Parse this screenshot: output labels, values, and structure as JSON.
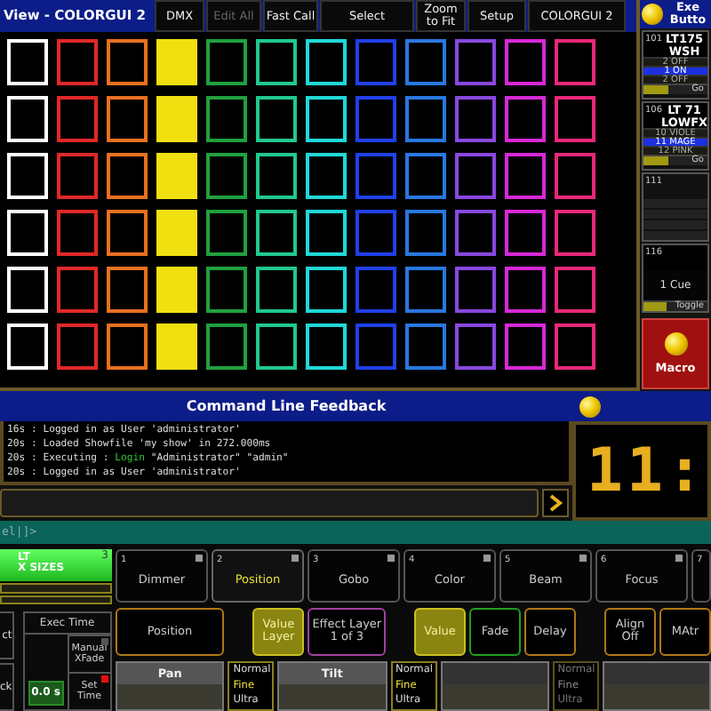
{
  "title_bar": {
    "title": "View - COLORGUI 2",
    "buttons": [
      {
        "label": "DMX",
        "disabled": false
      },
      {
        "label": "Edit All",
        "disabled": true
      },
      {
        "label": "Fast Call",
        "disabled": false
      },
      {
        "label": "Select",
        "disabled": false
      },
      {
        "label": "Zoom to Fit",
        "disabled": false
      },
      {
        "label": "Setup",
        "disabled": false
      },
      {
        "label": "COLORGUI 2",
        "disabled": false
      }
    ]
  },
  "color_grid": {
    "rows": [
      {
        "cells": [
          {
            "color": "#ffffff",
            "filled": false
          },
          {
            "color": "#e02828",
            "filled": false
          },
          {
            "color": "#e87020",
            "filled": false
          },
          {
            "color": "#f0e010",
            "filled": true
          },
          {
            "color": "#20a040",
            "filled": false
          },
          {
            "color": "#20c890",
            "filled": false
          },
          {
            "color": "#20d8d8",
            "filled": false
          },
          {
            "color": "#2040e8",
            "filled": false
          },
          {
            "color": "#2878e0",
            "filled": false
          },
          {
            "color": "#8848e0",
            "filled": false
          },
          {
            "color": "#d828d8",
            "filled": false
          },
          {
            "color": "#e82878",
            "filled": false
          }
        ]
      },
      {
        "cells": [
          {
            "color": "#ffffff",
            "filled": false
          },
          {
            "color": "#e02828",
            "filled": false
          },
          {
            "color": "#e87020",
            "filled": false
          },
          {
            "color": "#f0e010",
            "filled": true
          },
          {
            "color": "#20a040",
            "filled": false
          },
          {
            "color": "#20c890",
            "filled": false
          },
          {
            "color": "#20d8d8",
            "filled": false
          },
          {
            "color": "#2040e8",
            "filled": false
          },
          {
            "color": "#2878e0",
            "filled": false
          },
          {
            "color": "#8848e0",
            "filled": false
          },
          {
            "color": "#d828d8",
            "filled": false
          },
          {
            "color": "#e82878",
            "filled": false
          }
        ]
      },
      {
        "cells": [
          {
            "color": "#ffffff",
            "filled": false
          },
          {
            "color": "#e02828",
            "filled": false
          },
          {
            "color": "#e87020",
            "filled": false
          },
          {
            "color": "#f0e010",
            "filled": true
          },
          {
            "color": "#20a040",
            "filled": false
          },
          {
            "color": "#20c890",
            "filled": false
          },
          {
            "color": "#20d8d8",
            "filled": false
          },
          {
            "color": "#2040e8",
            "filled": false
          },
          {
            "color": "#2878e0",
            "filled": false
          },
          {
            "color": "#8848e0",
            "filled": false
          },
          {
            "color": "#d828d8",
            "filled": false
          },
          {
            "color": "#e82878",
            "filled": false
          }
        ]
      },
      {
        "cells": [
          {
            "color": "#ffffff",
            "filled": false
          },
          {
            "color": "#e02828",
            "filled": false
          },
          {
            "color": "#e87020",
            "filled": false
          },
          {
            "color": "#f0e010",
            "filled": true
          },
          {
            "color": "#20a040",
            "filled": false
          },
          {
            "color": "#20c890",
            "filled": false
          },
          {
            "color": "#20d8d8",
            "filled": false
          },
          {
            "color": "#2040e8",
            "filled": false
          },
          {
            "color": "#2878e0",
            "filled": false
          },
          {
            "color": "#8848e0",
            "filled": false
          },
          {
            "color": "#d828d8",
            "filled": false
          },
          {
            "color": "#e82878",
            "filled": false
          }
        ]
      },
      {
        "cells": [
          {
            "color": "#ffffff",
            "filled": false
          },
          {
            "color": "#e02828",
            "filled": false
          },
          {
            "color": "#e87020",
            "filled": false
          },
          {
            "color": "#f0e010",
            "filled": true
          },
          {
            "color": "#20a040",
            "filled": false
          },
          {
            "color": "#20c890",
            "filled": false
          },
          {
            "color": "#20d8d8",
            "filled": false
          },
          {
            "color": "#2040e8",
            "filled": false
          },
          {
            "color": "#2878e0",
            "filled": false
          },
          {
            "color": "#8848e0",
            "filled": false
          },
          {
            "color": "#d828d8",
            "filled": false
          },
          {
            "color": "#e82878",
            "filled": false
          }
        ]
      },
      {
        "cells": [
          {
            "color": "#ffffff",
            "filled": false
          },
          {
            "color": "#e02828",
            "filled": false
          },
          {
            "color": "#e87020",
            "filled": false
          },
          {
            "color": "#f0e010",
            "filled": true
          },
          {
            "color": "#20a040",
            "filled": false
          },
          {
            "color": "#20c890",
            "filled": false
          },
          {
            "color": "#20d8d8",
            "filled": false
          },
          {
            "color": "#2040e8",
            "filled": false
          },
          {
            "color": "#2878e0",
            "filled": false
          },
          {
            "color": "#8848e0",
            "filled": false
          },
          {
            "color": "#d828d8",
            "filled": false
          },
          {
            "color": "#e82878",
            "filled": false
          }
        ]
      }
    ]
  },
  "executor_panel": {
    "title": "Exe Butto",
    "executors": [
      {
        "kind": "cues",
        "number": "101",
        "name": "LT175 WSH",
        "cues": [
          {
            "label": "2 OFF",
            "selected": false
          },
          {
            "label": "1 ON",
            "selected": true
          },
          {
            "label": "2 OFF",
            "selected": false
          }
        ],
        "fader_label": "Go",
        "level": 0.4
      },
      {
        "kind": "cues",
        "number": "106",
        "name": "LT 71 LOWFX",
        "cues": [
          {
            "label": "10 VIOLE",
            "selected": false
          },
          {
            "label": "11 MAGE",
            "selected": true
          },
          {
            "label": "12 PINK",
            "selected": false
          }
        ],
        "fader_label": "Go",
        "level": 0.4
      },
      {
        "kind": "empty",
        "number": "111"
      },
      {
        "kind": "single",
        "number": "116",
        "cue": "1 Cue",
        "fader_label": "Toggle",
        "level": 0.35
      }
    ],
    "macro": {
      "label": "Macro"
    }
  },
  "command_line": {
    "title": "Command Line Feedback",
    "log": [
      {
        "parts": [
          {
            "kind": "plain",
            "text": "16s : Logged in as User 'administrator'"
          }
        ]
      },
      {
        "parts": [
          {
            "kind": "plain",
            "text": "20s : Loaded Showfile 'my show' in 272.000ms"
          }
        ]
      },
      {
        "parts": [
          {
            "kind": "plain",
            "text": "20s : Executing : "
          },
          {
            "kind": "command",
            "text": "Login"
          },
          {
            "kind": "plain",
            "text": " \"Administrator\" \"admin\""
          }
        ]
      },
      {
        "parts": [
          {
            "kind": "plain",
            "text": "20s : Logged in as User 'administrator'"
          }
        ]
      }
    ],
    "clock": "11:"
  },
  "prompt": "el|]>",
  "preset": {
    "title_lines": [
      "LT",
      "X SIZES"
    ],
    "number": "3"
  },
  "side_buttons": [
    "ct",
    "ck"
  ],
  "exec_time": {
    "title": "Exec Time",
    "value": "0.0 s",
    "manual_xfade": "Manual XFade",
    "set_time": {
      "label": "Set Time",
      "on": true
    }
  },
  "feature_tabs": [
    {
      "number": "1",
      "label": "Dimmer",
      "selected": false
    },
    {
      "number": "2",
      "label": "Position",
      "selected": true
    },
    {
      "number": "3",
      "label": "Gobo",
      "selected": false
    },
    {
      "number": "4",
      "label": "Color",
      "selected": false
    },
    {
      "number": "5",
      "label": "Beam",
      "selected": false
    },
    {
      "number": "6",
      "label": "Focus",
      "selected": false
    },
    {
      "number": "7",
      "selected": false
    }
  ],
  "button_groups": [
    {
      "buttons": [
        {
          "label": "Position",
          "color": "#b07818",
          "on": false
        }
      ]
    },
    {
      "buttons": [
        {
          "label": "Value Layer",
          "color": "#c8c020",
          "on": true
        },
        {
          "label": "Effect Layer 1 of 3",
          "color": "#a040a0",
          "on": false
        }
      ]
    },
    {
      "buttons": [
        {
          "label": "Value",
          "color": "#c8c020",
          "on": true
        },
        {
          "label": "Fade",
          "color": "#20a020",
          "on": false
        },
        {
          "label": "Delay",
          "color": "#b07818",
          "on": false
        }
      ]
    },
    {
      "buttons": [
        {
          "label": "Align Off",
          "color": "#b07818",
          "on": false
        },
        {
          "label": "MAtr",
          "color": "#b07818",
          "on": false
        }
      ]
    }
  ],
  "encoders": [
    {
      "kind": "encoder",
      "label": "Pan"
    },
    {
      "kind": "resolution",
      "disabled": false,
      "options": [
        {
          "label": "Normal",
          "selected": false
        },
        {
          "label": "Fine",
          "selected": true
        },
        {
          "label": "Ultra",
          "selected": false
        }
      ]
    },
    {
      "kind": "encoder",
      "label": "Tilt"
    },
    {
      "kind": "resolution",
      "disabled": false,
      "options": [
        {
          "label": "Normal",
          "selected": false
        },
        {
          "label": "Fine",
          "selected": true
        },
        {
          "label": "Ultra",
          "selected": false
        }
      ]
    },
    {
      "kind": "encoder"
    },
    {
      "kind": "resolution",
      "disabled": true,
      "options": [
        {
          "label": "Normal",
          "selected": false
        },
        {
          "label": "Fine",
          "selected": true
        },
        {
          "label": "Ultra",
          "selected": false
        }
      ]
    },
    {
      "kind": "encoder"
    }
  ]
}
